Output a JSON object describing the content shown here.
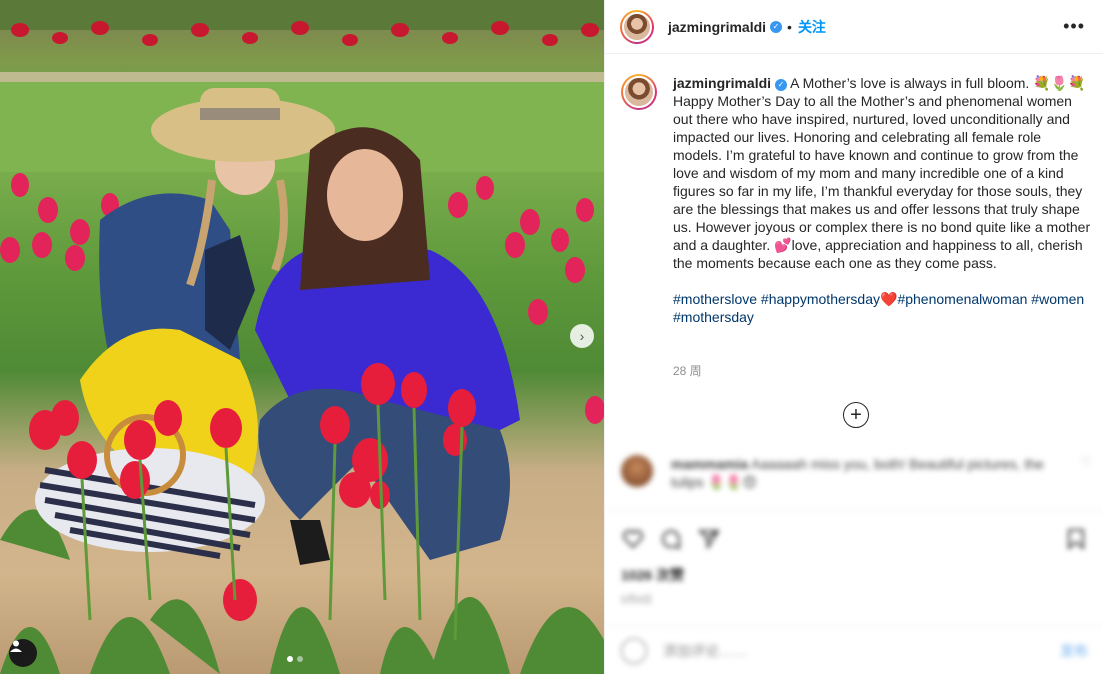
{
  "post": {
    "username": "jazmingrimaldi",
    "verified_mark": "✓",
    "follow_label": "关注",
    "separator": "•",
    "more_icon": "more-horizontal-icon",
    "caption": "A Mother’s love is always in full bloom. 💐🌷💐\nHappy Mother’s Day to all the Mother’s and phenomenal women out there who have inspired, nurtured, loved unconditionally and impacted our lives. Honoring and celebrating all female role models. I’m grateful to have known and continue to grow from the love and wisdom of my mom and many incredible one of a kind figures so far in my life, I’m thankful everyday for those souls, they are the blessings that makes us and offer lessons that truly shape us. However joyous or complex there is no bond quite like a mother and a daughter. 💕love, appreciation and happiness to all, cherish the moments because each one as they come pass.",
    "hashtags": "#motherslove #happymothersday❤️#phenomenalwoman #women #mothersday",
    "time_ago": "28 周"
  },
  "comment": {
    "username": "mammamia",
    "text": "Aaaaaah miss you, both! Beautiful pictures, the tulips 🌷🌷😍"
  },
  "actions": {
    "likes": "1026 次赞",
    "date": "5月9日",
    "icons": [
      "heart-icon",
      "comment-icon",
      "share-icon",
      "bookmark-icon"
    ]
  },
  "add_comment": {
    "placeholder": "添加评论……",
    "post_label": "发布"
  },
  "carousel": {
    "next_glyph": "›",
    "current": 1,
    "total": 2
  },
  "colors": {
    "accent": "#0095f6",
    "hashtag": "#00376b",
    "muted": "#8e8e8e"
  }
}
